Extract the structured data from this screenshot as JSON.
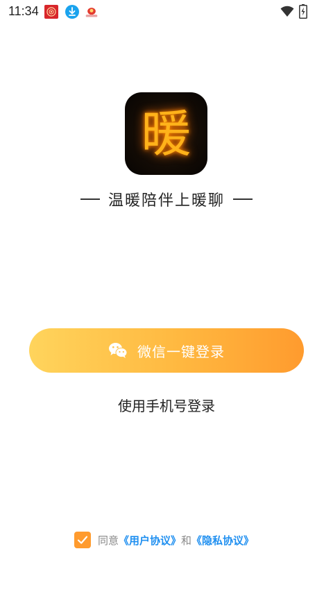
{
  "status_bar": {
    "time": "11:34",
    "notification_icons": [
      "calendar-app-icon",
      "download-icon",
      "cloud-app-icon"
    ],
    "wifi_icon": "wifi-icon",
    "battery_icon": "battery-charging-icon"
  },
  "app": {
    "logo_glyph": "暖",
    "slogan": "温暖陪伴上暖聊"
  },
  "login": {
    "wechat_label": "微信一键登录",
    "wechat_icon": "wechat-icon",
    "phone_label": "使用手机号登录"
  },
  "agreement": {
    "checked": true,
    "prefix": "同意",
    "user_agreement": "《用户协议》",
    "conjunction": "和",
    "privacy_policy": "《隐私协议》"
  },
  "colors": {
    "button_gradient_start": "#ffd45c",
    "button_gradient_end": "#ff9b2e",
    "checkbox": "#ff9b2e",
    "link": "#1f8ff0",
    "logo_glow": "#ffb21a"
  }
}
